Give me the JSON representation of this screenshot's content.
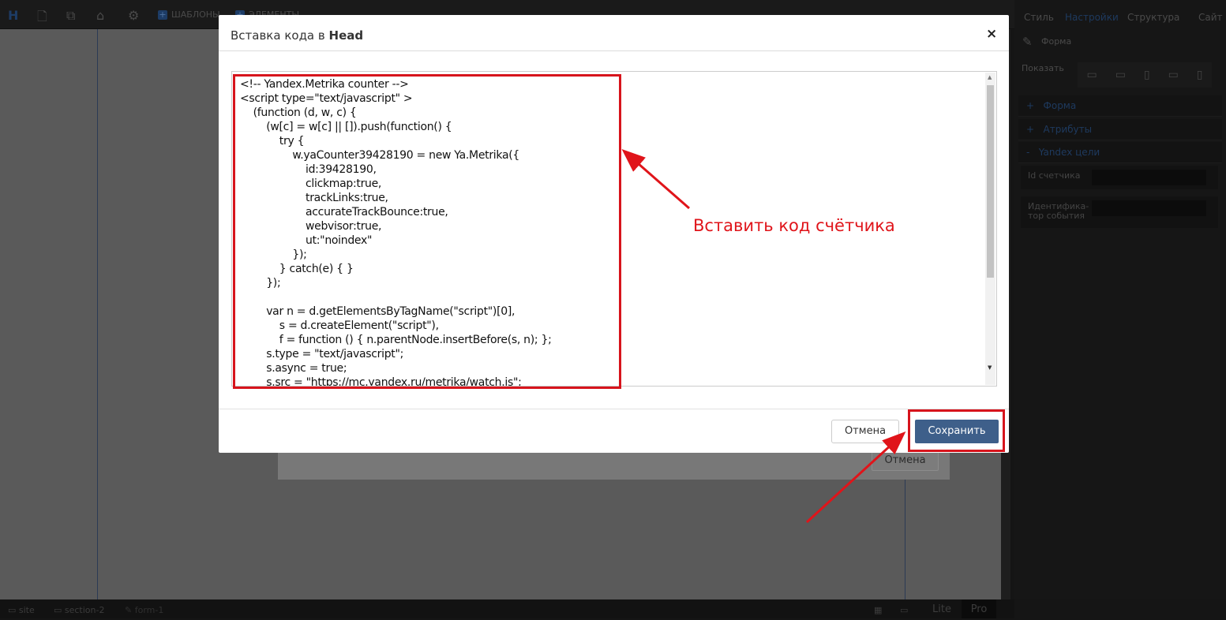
{
  "toolbar": {
    "templates": "ШАБЛОНЫ",
    "elements": "ЭЛЕМЕНТЫ"
  },
  "right_panel": {
    "tabs": [
      "Стиль",
      "Настройки",
      "Структура",
      "Сайт"
    ],
    "active_tab": "Настройки",
    "section_title": "Форма",
    "show_label": "Показать",
    "sections": [
      {
        "sign": "+",
        "label": "Форма"
      },
      {
        "sign": "+",
        "label": "Атрибуты"
      },
      {
        "sign": "-",
        "label": "Yandex цели"
      }
    ],
    "fields": [
      {
        "label": "Id счетчика"
      },
      {
        "label": "Идентифика-\nтор события"
      }
    ]
  },
  "statusbar": {
    "crumbs": [
      "site",
      "section-2",
      "form-1"
    ],
    "modes": [
      "Lite",
      "Pro"
    ]
  },
  "background_dialog": {
    "cancel": "Отмена"
  },
  "modal": {
    "title_prefix": "Вставка кода в ",
    "title_bold": "Head",
    "close": "×",
    "code": "<!-- Yandex.Metrika counter -->\n<script type=\"text/javascript\" >\n    (function (d, w, c) {\n        (w[c] = w[c] || []).push(function() {\n            try {\n                w.yaCounter39428190 = new Ya.Metrika({\n                    id:39428190,\n                    clickmap:true,\n                    trackLinks:true,\n                    accurateTrackBounce:true,\n                    webvisor:true,\n                    ut:\"noindex\"\n                });\n            } catch(e) { }\n        });\n\n        var n = d.getElementsByTagName(\"script\")[0],\n            s = d.createElement(\"script\"),\n            f = function () { n.parentNode.insertBefore(s, n); };\n        s.type = \"text/javascript\";\n        s.async = true;\n        s.src = \"https://mc.yandex.ru/metrika/watch.js\";",
    "cancel": "Отмена",
    "save": "Сохранить"
  },
  "annotation": {
    "text": "Вставить код счётчика",
    "color": "#e0141a"
  },
  "colors": {
    "save_button": "#3e5f8a",
    "highlight": "#d7141c"
  }
}
